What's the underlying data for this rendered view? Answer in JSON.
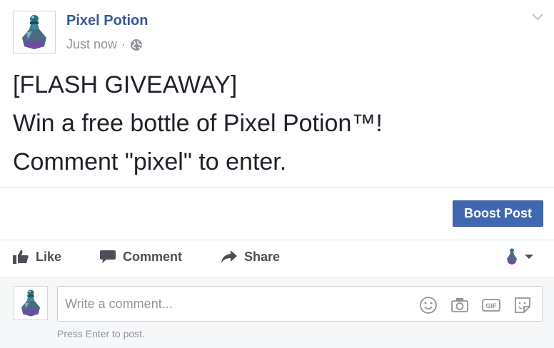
{
  "post": {
    "page_name": "Pixel Potion",
    "timestamp": "Just now",
    "separator": "·",
    "privacy_icon": "globe-icon",
    "menu_icon": "chevron-down-icon",
    "avatar_icon": "potion-bottle-icon",
    "body_lines": [
      "[FLASH GIVEAWAY]",
      "Win a free bottle of Pixel Potion™!",
      "Comment \"pixel\" to enter."
    ]
  },
  "boost": {
    "label": "Boost Post"
  },
  "actions": {
    "like": {
      "label": "Like",
      "icon": "thumbs-up-icon"
    },
    "comment": {
      "label": "Comment",
      "icon": "speech-bubble-icon"
    },
    "share": {
      "label": "Share",
      "icon": "share-arrow-icon"
    },
    "audience_icon": "potion-bottle-icon"
  },
  "comment_box": {
    "placeholder": "Write a comment...",
    "hint": "Press Enter to post.",
    "icons": [
      "emoji-icon",
      "camera-icon",
      "gif-icon",
      "sticker-icon"
    ]
  },
  "colors": {
    "link": "#365899",
    "button": "#4267b2",
    "muted": "#90949c",
    "text": "#1d2129"
  }
}
